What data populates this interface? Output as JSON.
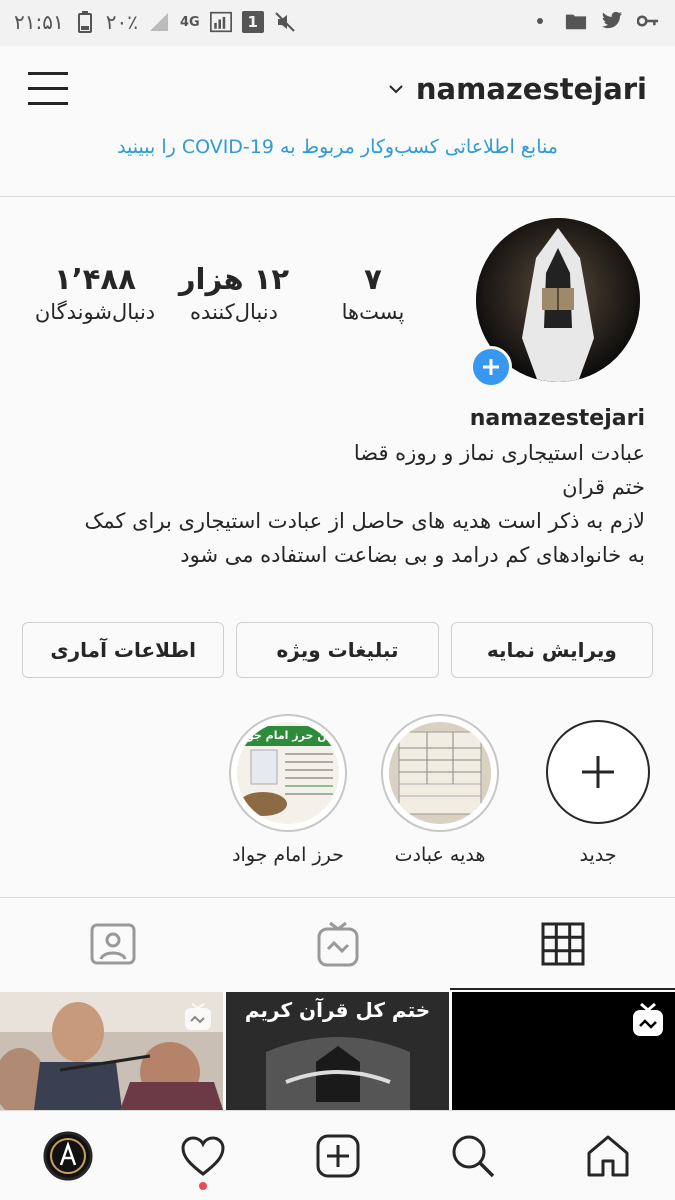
{
  "status_bar": {
    "time": "۲۱:۵۱",
    "battery": "۲۰٪",
    "network": "4G",
    "sim": "1",
    "icons": [
      "battery-icon",
      "signal-icon",
      "mute-icon",
      "dot-icon",
      "folder-icon",
      "twitter-icon",
      "key-icon"
    ]
  },
  "header": {
    "username": "namazestejari",
    "covid_text": "منابع اطلاعاتی کسب‌وکار مربوط به COVID-19 را ببینید"
  },
  "profile": {
    "stats": [
      {
        "number": "۷",
        "label": "پست‌ها"
      },
      {
        "number": "۱۲ هزار",
        "label": "دنبال‌کننده"
      },
      {
        "number": "۱٬۴۸۸",
        "label": "دنبال‌شوندگان"
      }
    ],
    "name": "namazestejari",
    "bio_lines": [
      "عبادت استیجاری نماز و روزه قضا",
      "ختم قران",
      "لازم به ذکر است هدیه های حاصل از عبادت استیجاری برای کمک",
      "به خانوادهای کم درامد و بی بضاعت استفاده  می شود"
    ]
  },
  "actions": {
    "edit_profile": "ویرایش نمایه",
    "promotions": "تبلیغات ویژه",
    "insights": "اطلاعات آماری"
  },
  "highlights": [
    {
      "label": "جدید"
    },
    {
      "label": "هدیه عبادت"
    },
    {
      "label": "حرز امام جواد",
      "image_text": "متن حرز امام جواد"
    }
  ],
  "posts": [
    {
      "caption": ""
    },
    {
      "caption": "ختم کل قرآن کریم"
    },
    {
      "caption": ""
    }
  ],
  "colors": {
    "accent": "#3897f0",
    "link": "#2f9bd6",
    "notification": "#ed4956"
  }
}
